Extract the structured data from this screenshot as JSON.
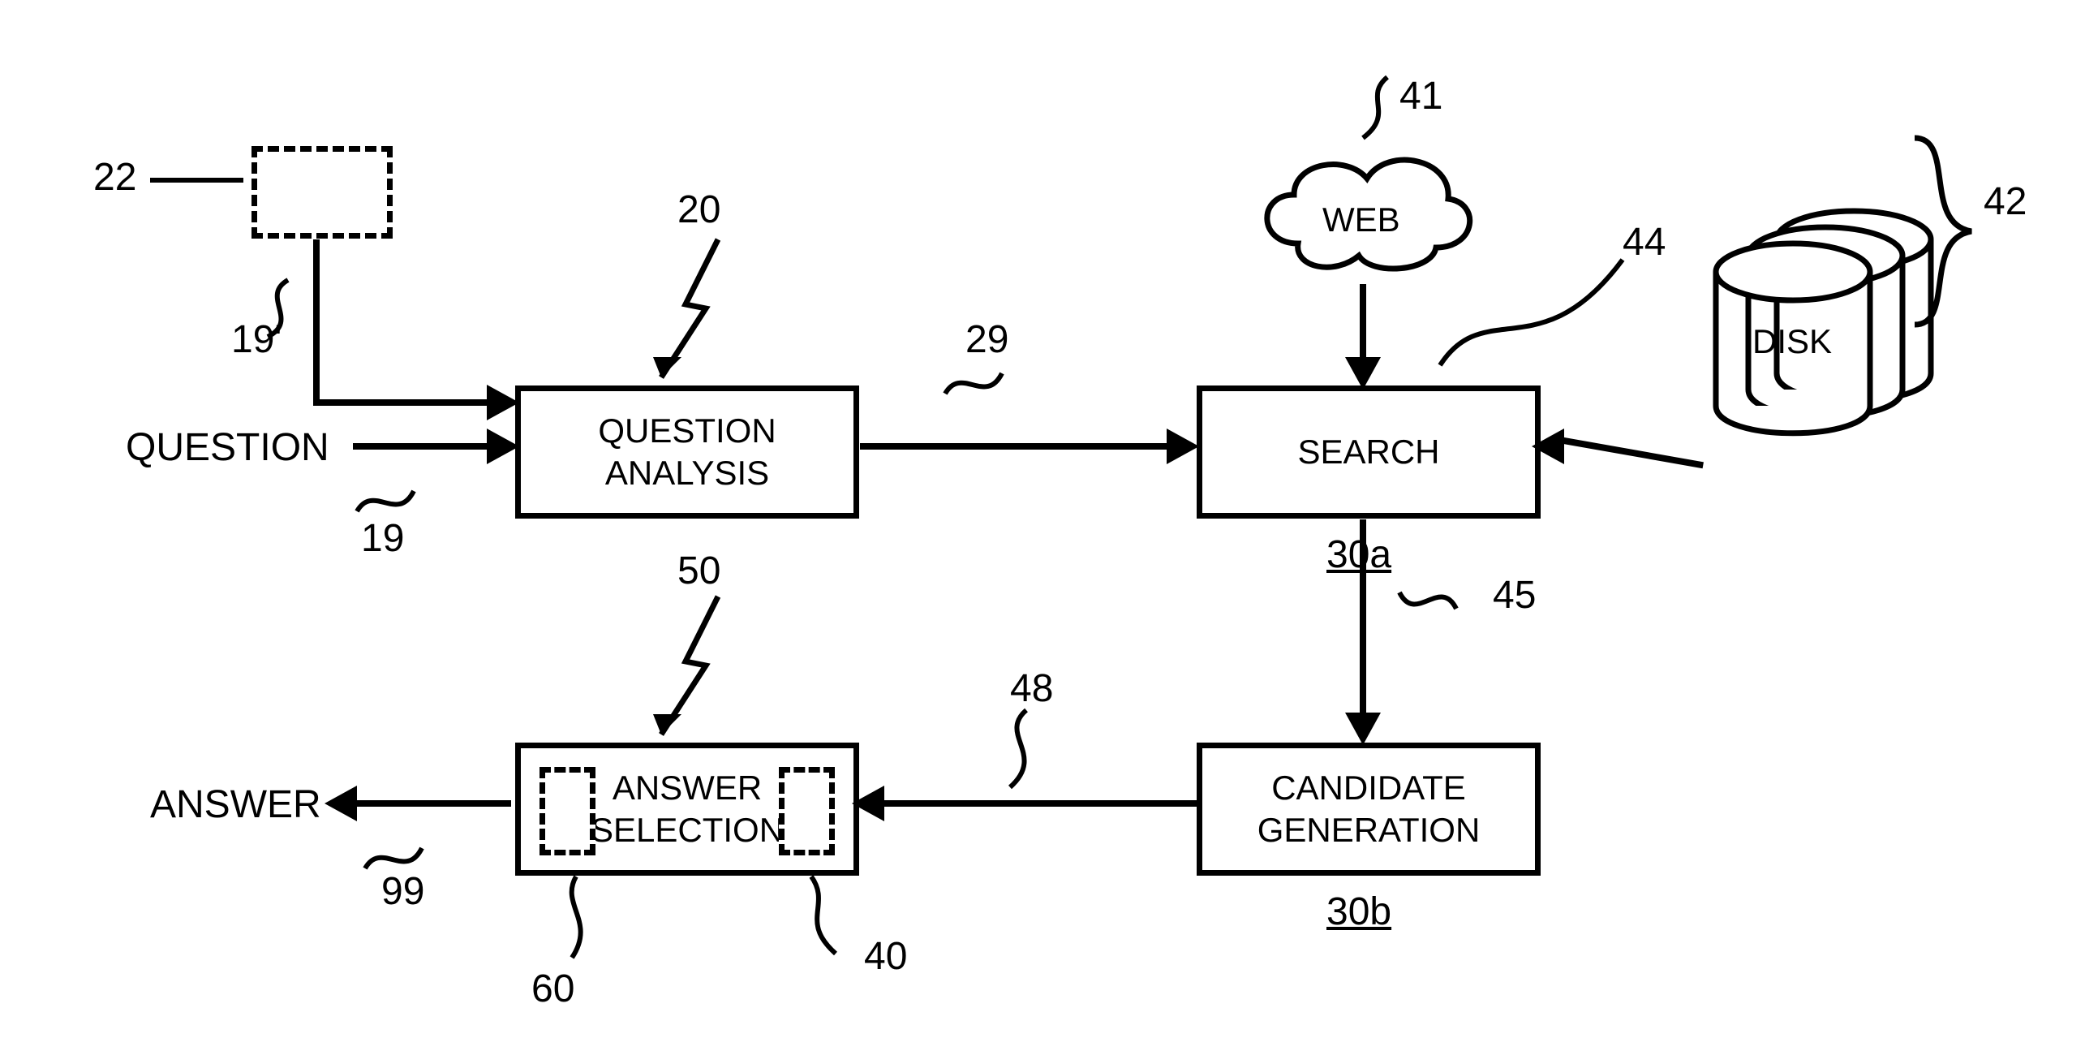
{
  "labels": {
    "question": "QUESTION",
    "answer": "ANSWER"
  },
  "blocks": {
    "question_analysis": "QUESTION\nANALYSIS",
    "search": "SEARCH",
    "candidate_generation": "CANDIDATE\nGENERATION",
    "answer_selection": "ANSWER\nSELECTION",
    "web": "WEB",
    "disk": "DISK"
  },
  "refs": {
    "r19": "19",
    "r19p": "19'",
    "r20": "20",
    "r22": "22",
    "r29": "29",
    "r30a": "30a",
    "r30b": "30b",
    "r40": "40",
    "r41": "41",
    "r42": "42",
    "r44": "44",
    "r45": "45",
    "r48": "48",
    "r50": "50",
    "r60": "60",
    "r99": "99"
  }
}
